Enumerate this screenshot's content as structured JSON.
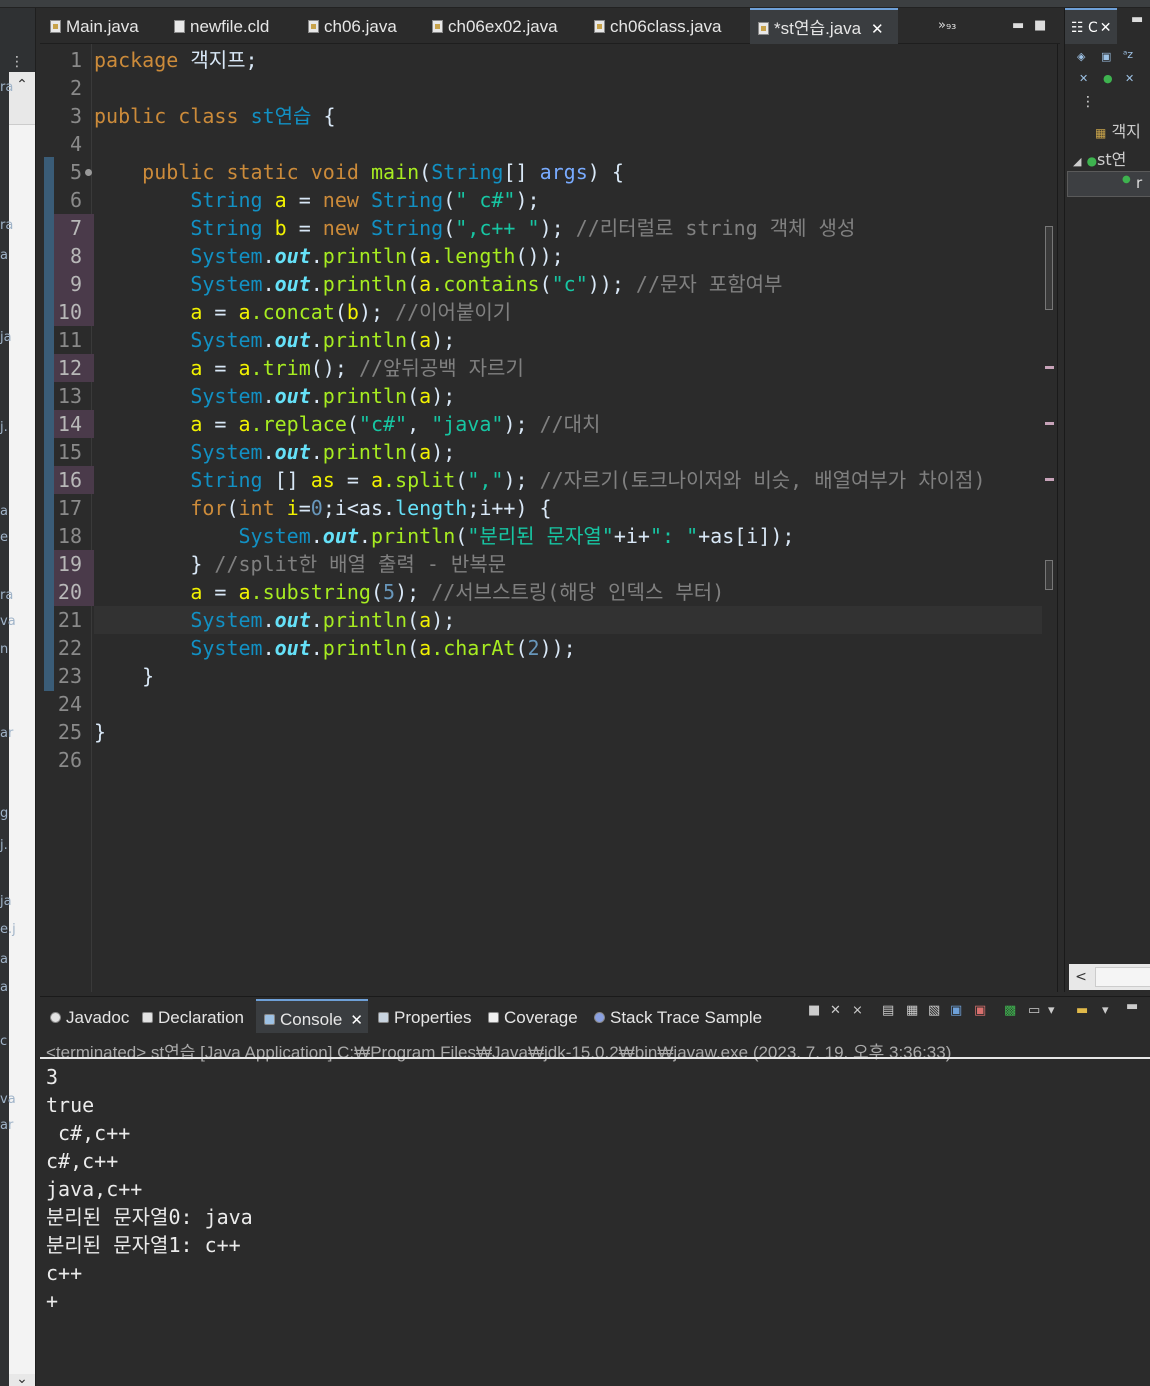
{
  "editor": {
    "tabs": [
      {
        "label": "Main.java",
        "icon": "java-file-icon"
      },
      {
        "label": "newfile.cld",
        "icon": "file-icon"
      },
      {
        "label": "ch06.java",
        "icon": "java-file-icon"
      },
      {
        "label": "ch06ex02.java",
        "icon": "java-file-icon"
      },
      {
        "label": "ch06class.java",
        "icon": "java-file-icon"
      },
      {
        "label": "*st연습.java",
        "icon": "java-file-icon"
      }
    ],
    "more_tabs": "»₉₃",
    "close_symbol": "✕"
  },
  "outline": {
    "tab_label": "☷ C",
    "package": "객지",
    "class": "st연",
    "method": "r"
  },
  "left_view_fragments": [
    "ra",
    "ra",
    "a",
    "ja",
    "j.",
    "a",
    "e",
    "ra",
    "va",
    "n",
    "ar",
    "g",
    "j.",
    "ja",
    "e.j",
    "a",
    "a",
    "c",
    "va",
    "ar"
  ],
  "bottom": {
    "tabs": [
      {
        "label": "Javadoc",
        "icon": "javadoc-icon"
      },
      {
        "label": "Declaration",
        "icon": "declaration-icon"
      },
      {
        "label": "Console",
        "icon": "console-icon"
      },
      {
        "label": "Properties",
        "icon": "properties-icon"
      },
      {
        "label": "Coverage",
        "icon": "coverage-icon"
      },
      {
        "label": "Stack Trace Sample",
        "icon": "stack-trace-icon"
      }
    ],
    "console_header": "<terminated> st연습 [Java Application] C:₩Program Files₩Java₩jdk-15.0.2₩bin₩javaw.exe  (2023. 7. 19. 오후 3:36:33)",
    "output": [
      "3",
      "true",
      " c#,c++",
      "c#,c++",
      "java,c++",
      "분리된 문자열0: java",
      "분리된 문자열1: c++",
      "c++",
      "+"
    ]
  },
  "code_lines": [
    "1",
    "2",
    "3",
    "4",
    "5",
    "6",
    "7",
    "8",
    "9",
    "10",
    "11",
    "12",
    "13",
    "14",
    "15",
    "16",
    "17",
    "18",
    "19",
    "20",
    "21",
    "22",
    "23",
    "24",
    "25",
    "26"
  ],
  "code": {
    "l1_kw": "package",
    "l1_rest": " 객지프;",
    "l3_kw1": "public",
    "l3_kw2": "class",
    "l3_name": "st연습",
    "l3_rest": " {",
    "l5_kw1": "public",
    "l5_kw2": "static",
    "l5_kw3": "void",
    "l5_m": "main",
    "l5_p1": "(",
    "l5_t": "String",
    "l5_p2": "[] ",
    "l5_a": "args",
    "l5_p3": ") {",
    "l6_t": "String",
    "l6_v": "a",
    "l6_eq": " = ",
    "l6_new": "new",
    "l6_t2": "String",
    "l6_p": "(",
    "l6_s": "\" c#\"",
    "l6_e": ");",
    "l7_t": "String",
    "l7_v": "b",
    "l7_eq": " = ",
    "l7_new": "new",
    "l7_t2": "String",
    "l7_p": "(",
    "l7_s": "\",c++ \"",
    "l7_e": "); ",
    "l7_c": "//리터럴로 string 객체 생성",
    "sys": "System",
    "out": "out",
    "println": "println",
    "l8_m": "a",
    "l8_x": ".length",
    "l8_e": "());",
    "l9_x": ".contains",
    "l9_s": "\"c\"",
    "l9_e": ")); ",
    "l9_c": "//문자 포함여부",
    "l10_v": "a",
    "l10_eq": " = ",
    "l10_a": "a",
    "l10_m": ".concat",
    "l10_p": "(",
    "l10_b": "b",
    "l10_e": "); ",
    "l10_c": "//이어붙이기",
    "arg_a": "a",
    "l12_m": ".trim",
    "l12_e": "(); ",
    "l12_c": "//앞뒤공백 자르기",
    "l14_m": ".replace",
    "l14_s1": "\"c#\"",
    "l14_comma": ", ",
    "l14_s2": "\"java\"",
    "l14_e": "); ",
    "l14_c": "//대치",
    "l16_t": "String",
    "l16_br": " [] ",
    "l16_v": "as",
    "l16_m": ".split",
    "l16_s": "\",\"",
    "l16_e": "); ",
    "l16_c": "//자르기(토크나이저와 비슷, 배열여부가 차이점)",
    "l17_kw": "for",
    "l17_p": "(",
    "l17_int": "int",
    "l17_i": " i",
    "l17_eq": "=",
    "l17_0": "0",
    "l17_semi": ";i<as.",
    "l17_len": "length",
    "l17_rest": ";i++) {",
    "l18_s1": "\"분리된 문자열\"",
    "l18_mid": "+i+",
    "l18_s2": "\": \"",
    "l18_e": "+as[i]);",
    "l19_b": "} ",
    "l19_c": "//split한 배열 출력 - 반복문",
    "l20_m": ".substring",
    "l20_n": "5",
    "l20_e": "); ",
    "l20_c": "//서브스트링(해당 인덱스 부터)",
    "l22_m": ".charAt",
    "l22_n": "2",
    "l22_e": "));",
    "close1": "}",
    "close2": "}"
  }
}
